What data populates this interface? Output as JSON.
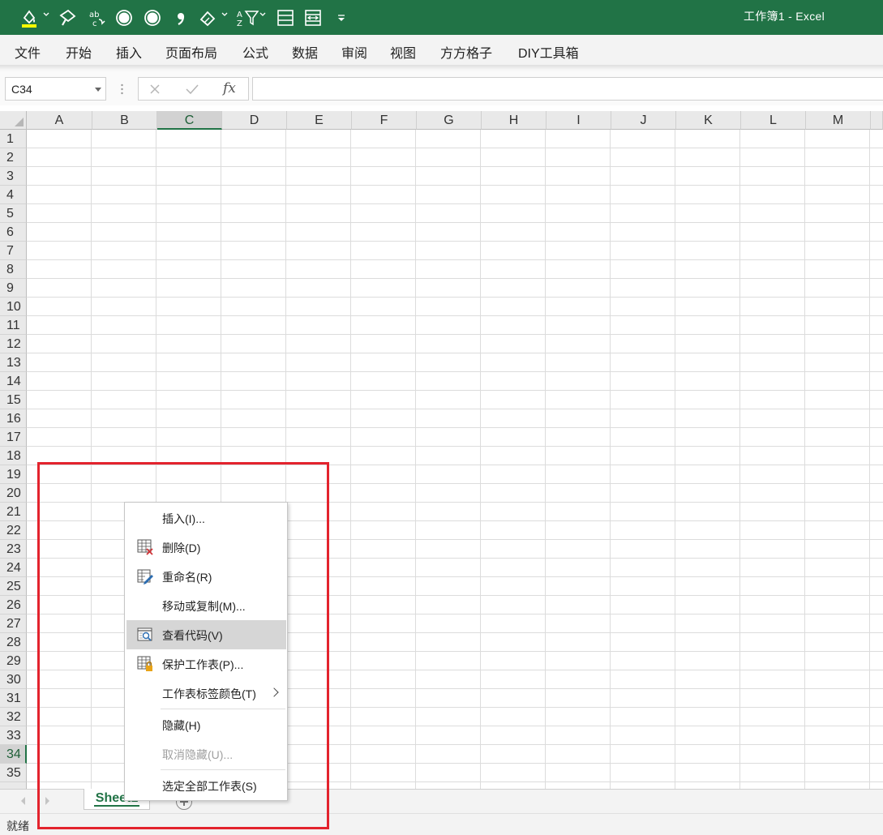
{
  "app": {
    "window_title": "工作簿1 - Excel",
    "colors": {
      "accent": "#217346",
      "highlight_box": "#e3232d",
      "fill_swatch": "#ffff00"
    }
  },
  "quick_access": [
    {
      "name": "fill-color-icon",
      "has_dropdown": true
    },
    {
      "name": "format-painter-icon",
      "has_dropdown": false
    },
    {
      "name": "spell-check-icon",
      "has_dropdown": false
    },
    {
      "name": "record-circle-icon",
      "has_dropdown": false
    },
    {
      "name": "record-circle-icon-2",
      "has_dropdown": false
    },
    {
      "name": "comma-icon",
      "has_dropdown": false
    },
    {
      "name": "eraser-icon",
      "has_dropdown": true
    },
    {
      "name": "sort-filter-icon",
      "has_dropdown": true
    },
    {
      "name": "rows-icon",
      "has_dropdown": false
    },
    {
      "name": "merge-cells-icon",
      "has_dropdown": false
    },
    {
      "name": "customize-quick-access-icon",
      "has_dropdown": false
    }
  ],
  "menubar": {
    "items": [
      "文件",
      "开始",
      "插入",
      "页面布局",
      "公式",
      "数据",
      "审阅",
      "视图",
      "方方格子",
      "DIY工具箱"
    ]
  },
  "formula_bar": {
    "name_box": "C34",
    "cancel_icon": "close-icon",
    "enter_icon": "check-icon",
    "fx_label": "fx",
    "formula": ""
  },
  "grid": {
    "columns": [
      "A",
      "B",
      "C",
      "D",
      "E",
      "F",
      "G",
      "H",
      "I",
      "J",
      "K",
      "L",
      "M"
    ],
    "rows": [
      "1",
      "2",
      "3",
      "4",
      "5",
      "6",
      "7",
      "8",
      "9",
      "10",
      "11",
      "12",
      "13",
      "14",
      "15",
      "16",
      "17",
      "18",
      "19",
      "20",
      "21",
      "22",
      "23",
      "24",
      "25",
      "26",
      "27",
      "28",
      "29",
      "30",
      "31",
      "32",
      "33",
      "34",
      "35"
    ],
    "selected_column": "C",
    "selected_row": "34"
  },
  "sheets": {
    "tabs": [
      "Sheet1"
    ],
    "active": "Sheet1"
  },
  "context_menu": {
    "items": [
      {
        "id": "insert",
        "label": "插入(I)...",
        "icon": "",
        "disabled": false,
        "highlighted": false,
        "submenu": false
      },
      {
        "id": "delete",
        "label": "删除(D)",
        "icon": "delete-sheet-icon",
        "disabled": false,
        "highlighted": false,
        "submenu": false
      },
      {
        "id": "rename",
        "label": "重命名(R)",
        "icon": "rename-sheet-icon",
        "disabled": false,
        "highlighted": false,
        "submenu": false
      },
      {
        "id": "move-copy",
        "label": "移动或复制(M)...",
        "icon": "",
        "disabled": false,
        "highlighted": false,
        "submenu": false
      },
      {
        "id": "view-code",
        "label": "查看代码(V)",
        "icon": "view-code-icon",
        "disabled": false,
        "highlighted": true,
        "submenu": false
      },
      {
        "id": "protect",
        "label": "保护工作表(P)...",
        "icon": "protect-sheet-icon",
        "disabled": false,
        "highlighted": false,
        "submenu": false
      },
      {
        "id": "tab-color",
        "label": "工作表标签颜色(T)",
        "icon": "",
        "disabled": false,
        "highlighted": false,
        "submenu": true
      },
      {
        "id": "hide",
        "label": "隐藏(H)",
        "icon": "",
        "disabled": false,
        "highlighted": false,
        "submenu": false
      },
      {
        "id": "unhide",
        "label": "取消隐藏(U)...",
        "icon": "",
        "disabled": true,
        "highlighted": false,
        "submenu": false
      },
      {
        "id": "select-all",
        "label": "选定全部工作表(S)",
        "icon": "",
        "disabled": false,
        "highlighted": false,
        "submenu": false
      }
    ]
  },
  "status_bar": {
    "text": "就绪"
  }
}
